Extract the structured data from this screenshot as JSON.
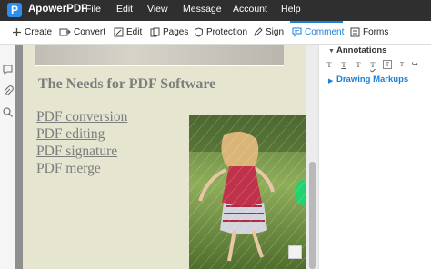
{
  "app": {
    "logo_letter": "P",
    "name": "ApowerPDF",
    "menu": [
      "File",
      "Edit",
      "View",
      "Message",
      "Account",
      "Help"
    ]
  },
  "toolbar": {
    "items": [
      {
        "label": "Create",
        "icon": "plus-icon"
      },
      {
        "label": "Convert",
        "icon": "convert-icon"
      },
      {
        "label": "Edit",
        "icon": "edit-icon"
      },
      {
        "label": "Pages",
        "icon": "pages-icon"
      },
      {
        "label": "Protection",
        "icon": "shield-icon"
      },
      {
        "label": "Sign",
        "icon": "pen-icon"
      },
      {
        "label": "Comment",
        "icon": "comment-icon",
        "active": true
      },
      {
        "label": "Forms",
        "icon": "forms-icon"
      }
    ]
  },
  "left_rail": [
    "comment-list-icon",
    "attachment-icon",
    "search-icon"
  ],
  "document": {
    "heading": "The Needs for PDF Software",
    "features": [
      "PDF conversion",
      "PDF editing",
      "PDF signature",
      "PDF merge"
    ]
  },
  "panel": {
    "annotations_title": "Annotations",
    "annotation_tools": [
      "T",
      "T",
      "T",
      "T",
      "T",
      "T"
    ],
    "redo_icon": "redo-icon",
    "drawing_markups_title": "Drawing Markups"
  },
  "colors": {
    "titlebar": "#2f2f2f",
    "accent": "#1a7fd9",
    "page": "#e6e5d0"
  }
}
